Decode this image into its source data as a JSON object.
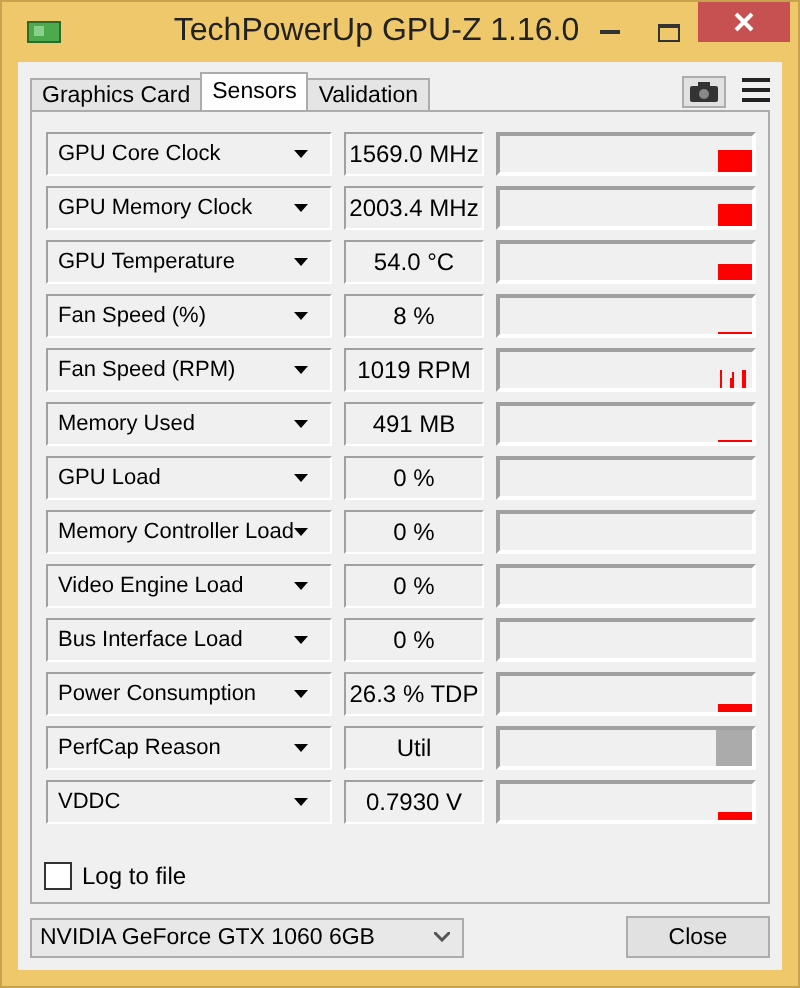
{
  "window": {
    "title": "TechPowerUp GPU-Z 1.16.0"
  },
  "tabs": [
    {
      "label": "Graphics Card",
      "selected": false
    },
    {
      "label": "Sensors",
      "selected": true
    },
    {
      "label": "Validation",
      "selected": false
    }
  ],
  "sensors": [
    {
      "name": "GPU Core Clock",
      "value": "1569.0 MHz"
    },
    {
      "name": "GPU Memory Clock",
      "value": "2003.4 MHz"
    },
    {
      "name": "GPU Temperature",
      "value": "54.0 °C"
    },
    {
      "name": "Fan Speed (%)",
      "value": "8 %"
    },
    {
      "name": "Fan Speed (RPM)",
      "value": "1019 RPM"
    },
    {
      "name": "Memory Used",
      "value": "491 MB"
    },
    {
      "name": "GPU Load",
      "value": "0 %"
    },
    {
      "name": "Memory Controller Load",
      "value": "0 %"
    },
    {
      "name": "Video Engine Load",
      "value": "0 %"
    },
    {
      "name": "Bus Interface Load",
      "value": "0 %"
    },
    {
      "name": "Power Consumption",
      "value": "26.3 % TDP"
    },
    {
      "name": "PerfCap Reason",
      "value": "Util"
    },
    {
      "name": "VDDC",
      "value": "0.7930 V"
    }
  ],
  "log_to_file": {
    "label": "Log to file",
    "checked": false
  },
  "gpu_select": {
    "value": "NVIDIA GeForce GTX 1060 6GB"
  },
  "buttons": [
    "Close"
  ]
}
